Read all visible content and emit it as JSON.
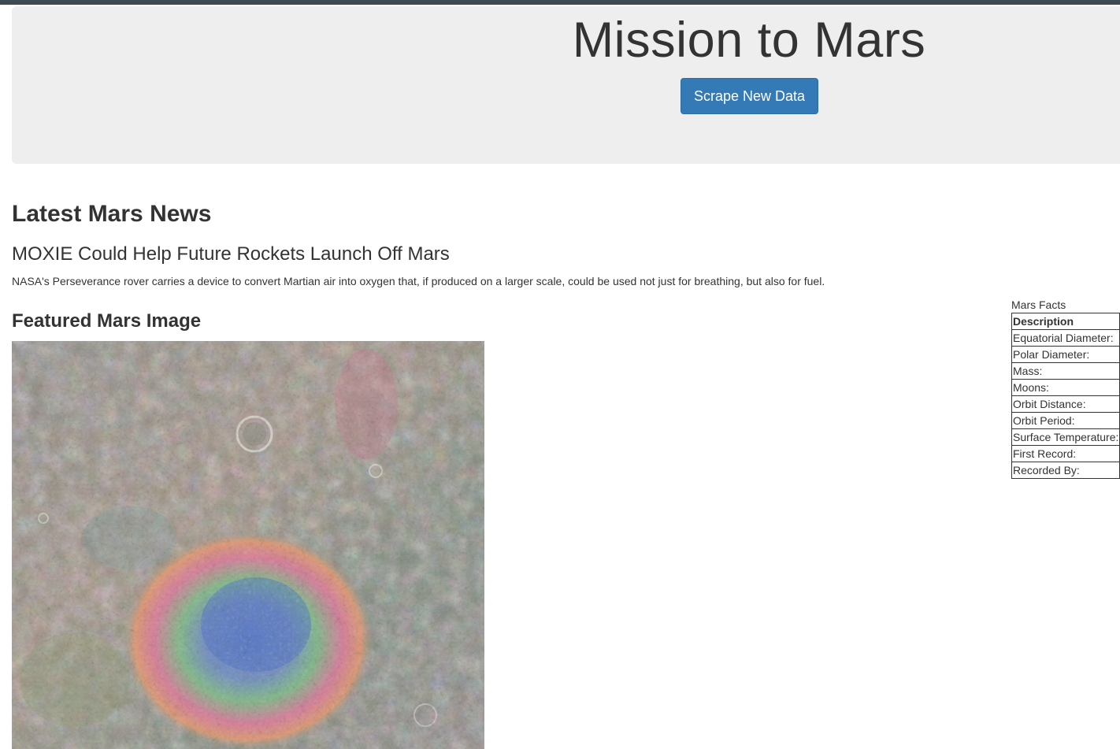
{
  "header": {
    "title": "Mission to Mars",
    "scrape_button_label": "Scrape New Data"
  },
  "news": {
    "section_heading": "Latest Mars News",
    "title": "MOXIE Could Help Future Rockets Launch Off Mars",
    "teaser": "NASA's Perseverance rover carries a device to convert Martian air into oxygen that, if produced on a larger scale, could be used not just for breathing, but also for fuel."
  },
  "featured_image": {
    "section_heading": "Featured Mars Image"
  },
  "facts": {
    "caption": "Mars Facts",
    "header_label": "Description",
    "rows": [
      {
        "label": "Equatorial Diameter:"
      },
      {
        "label": "Polar Diameter:"
      },
      {
        "label": "Mass:"
      },
      {
        "label": "Moons:"
      },
      {
        "label": "Orbit Distance:"
      },
      {
        "label": "Orbit Period:"
      },
      {
        "label": "Surface Temperature:"
      },
      {
        "label": "First Record:"
      },
      {
        "label": "Recorded By:"
      }
    ]
  },
  "colors": {
    "top_bar": "#3e4a52",
    "jumbotron_bg": "#eeeeee",
    "button_primary": "#337ab7",
    "text": "#333333"
  }
}
